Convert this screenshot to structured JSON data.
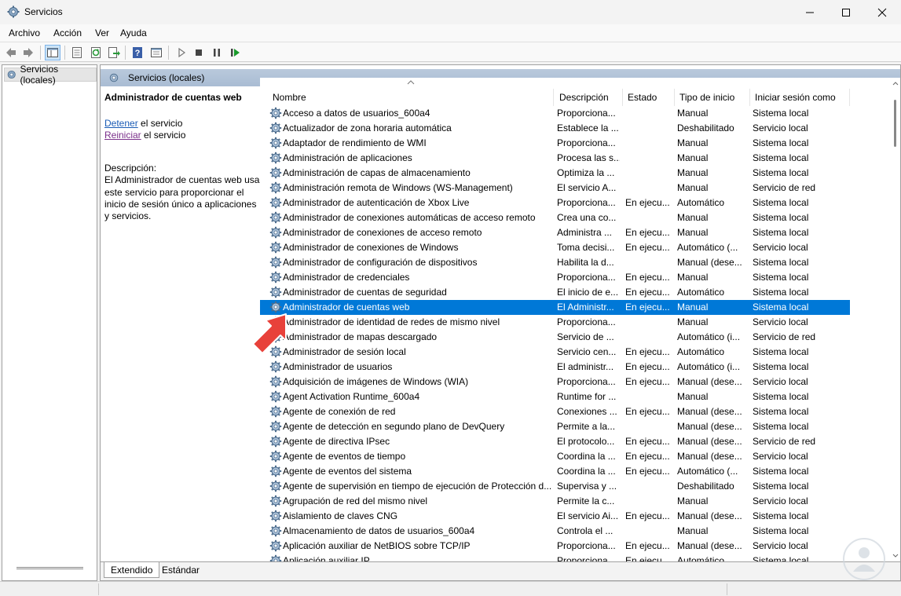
{
  "window": {
    "title": "Servicios"
  },
  "menu": [
    {
      "label": "Archivo"
    },
    {
      "label": "Acción"
    },
    {
      "label": "Ver"
    },
    {
      "label": "Ayuda"
    }
  ],
  "tree": {
    "item": "Servicios (locales)"
  },
  "panel": {
    "header": "Servicios (locales)",
    "selected_title": "Administrador de cuentas web",
    "action1_link": "Detener",
    "action1_rest": " el servicio",
    "action2_link": "Reiniciar",
    "action2_rest": " el servicio",
    "desc_label": "Descripción:",
    "desc_text": "El Administrador de cuentas web usa este servicio para proporcionar el inicio de sesión único a aplicaciones y servicios."
  },
  "columns": [
    "Nombre",
    "Descripción",
    "Estado",
    "Tipo de inicio",
    "Iniciar sesión como"
  ],
  "rows": [
    {
      "name": "Acceso a datos de usuarios_600a4",
      "desc": "Proporciona...",
      "state": "",
      "start": "Manual",
      "logon": "Sistema local"
    },
    {
      "name": "Actualizador de zona horaria automática",
      "desc": "Establece la ...",
      "state": "",
      "start": "Deshabilitado",
      "logon": "Servicio local"
    },
    {
      "name": "Adaptador de rendimiento de WMI",
      "desc": "Proporciona...",
      "state": "",
      "start": "Manual",
      "logon": "Sistema local"
    },
    {
      "name": "Administración de aplicaciones",
      "desc": "Procesa las s...",
      "state": "",
      "start": "Manual",
      "logon": "Sistema local"
    },
    {
      "name": "Administración de capas de almacenamiento",
      "desc": "Optimiza la ...",
      "state": "",
      "start": "Manual",
      "logon": "Sistema local"
    },
    {
      "name": "Administración remota de Windows (WS-Management)",
      "desc": "El servicio A...",
      "state": "",
      "start": "Manual",
      "logon": "Servicio de red"
    },
    {
      "name": "Administrador de autenticación de Xbox Live",
      "desc": "Proporciona...",
      "state": "En ejecu...",
      "start": "Automático",
      "logon": "Sistema local"
    },
    {
      "name": "Administrador de conexiones automáticas de acceso remoto",
      "desc": "Crea una co...",
      "state": "",
      "start": "Manual",
      "logon": "Sistema local"
    },
    {
      "name": "Administrador de conexiones de acceso remoto",
      "desc": "Administra ...",
      "state": "En ejecu...",
      "start": "Manual",
      "logon": "Sistema local"
    },
    {
      "name": "Administrador de conexiones de Windows",
      "desc": "Toma decisi...",
      "state": "En ejecu...",
      "start": "Automático (...",
      "logon": "Servicio local"
    },
    {
      "name": "Administrador de configuración de dispositivos",
      "desc": "Habilita la d...",
      "state": "",
      "start": "Manual (dese...",
      "logon": "Sistema local"
    },
    {
      "name": "Administrador de credenciales",
      "desc": "Proporciona...",
      "state": "En ejecu...",
      "start": "Manual",
      "logon": "Sistema local"
    },
    {
      "name": "Administrador de cuentas de seguridad",
      "desc": "El inicio de e...",
      "state": "En ejecu...",
      "start": "Automático",
      "logon": "Sistema local"
    },
    {
      "name": "Administrador de cuentas web",
      "desc": "El Administr...",
      "state": "En ejecu...",
      "start": "Manual",
      "logon": "Sistema local",
      "selected": true
    },
    {
      "name": "Administrador de identidad de redes de mismo nivel",
      "desc": "Proporciona...",
      "state": "",
      "start": "Manual",
      "logon": "Servicio local"
    },
    {
      "name": "Administrador de mapas descargado",
      "desc": "Servicio de ...",
      "state": "",
      "start": "Automático (i...",
      "logon": "Servicio de red"
    },
    {
      "name": "Administrador de sesión local",
      "desc": "Servicio cen...",
      "state": "En ejecu...",
      "start": "Automático",
      "logon": "Sistema local"
    },
    {
      "name": "Administrador de usuarios",
      "desc": "El administr...",
      "state": "En ejecu...",
      "start": "Automático (i...",
      "logon": "Sistema local"
    },
    {
      "name": "Adquisición de imágenes de Windows (WIA)",
      "desc": "Proporciona...",
      "state": "En ejecu...",
      "start": "Manual (dese...",
      "logon": "Servicio local"
    },
    {
      "name": "Agent Activation Runtime_600a4",
      "desc": "Runtime for ...",
      "state": "",
      "start": "Manual",
      "logon": "Sistema local"
    },
    {
      "name": "Agente de conexión de red",
      "desc": "Conexiones ...",
      "state": "En ejecu...",
      "start": "Manual (dese...",
      "logon": "Sistema local"
    },
    {
      "name": "Agente de detección en segundo plano de DevQuery",
      "desc": "Permite a la...",
      "state": "",
      "start": "Manual (dese...",
      "logon": "Sistema local"
    },
    {
      "name": "Agente de directiva IPsec",
      "desc": "El protocolo...",
      "state": "En ejecu...",
      "start": "Manual (dese...",
      "logon": "Servicio de red"
    },
    {
      "name": "Agente de eventos de tiempo",
      "desc": "Coordina la ...",
      "state": "En ejecu...",
      "start": "Manual (dese...",
      "logon": "Servicio local"
    },
    {
      "name": "Agente de eventos del sistema",
      "desc": "Coordina la ...",
      "state": "En ejecu...",
      "start": "Automático (...",
      "logon": "Sistema local"
    },
    {
      "name": "Agente de supervisión en tiempo de ejecución de Protección d...",
      "desc": "Supervisa y ...",
      "state": "",
      "start": "Deshabilitado",
      "logon": "Sistema local"
    },
    {
      "name": "Agrupación de red del mismo nivel",
      "desc": "Permite la c...",
      "state": "",
      "start": "Manual",
      "logon": "Servicio local"
    },
    {
      "name": "Aislamiento de claves CNG",
      "desc": "El servicio Ai...",
      "state": "En ejecu...",
      "start": "Manual (dese...",
      "logon": "Sistema local"
    },
    {
      "name": "Almacenamiento de datos de usuarios_600a4",
      "desc": "Controla el ...",
      "state": "",
      "start": "Manual",
      "logon": "Sistema local"
    },
    {
      "name": "Aplicación auxiliar de NetBIOS sobre TCP/IP",
      "desc": "Proporciona...",
      "state": "En ejecu...",
      "start": "Manual (dese...",
      "logon": "Servicio local"
    },
    {
      "name": "Aplicación auxiliar IP",
      "desc": "Proporciona...",
      "state": "En ejecu...",
      "start": "Automático",
      "logon": "Sistema local"
    }
  ],
  "tabs": [
    "Extendido",
    "Estándar"
  ],
  "colors": {
    "selection": "#0078d7",
    "header": "#b9c9dc",
    "arrow": "#e8413a"
  },
  "icons": [
    "gear-icon",
    "back-icon",
    "forward-icon",
    "play-icon",
    "stop-icon",
    "pause-icon",
    "restart-icon",
    "help-icon"
  ]
}
